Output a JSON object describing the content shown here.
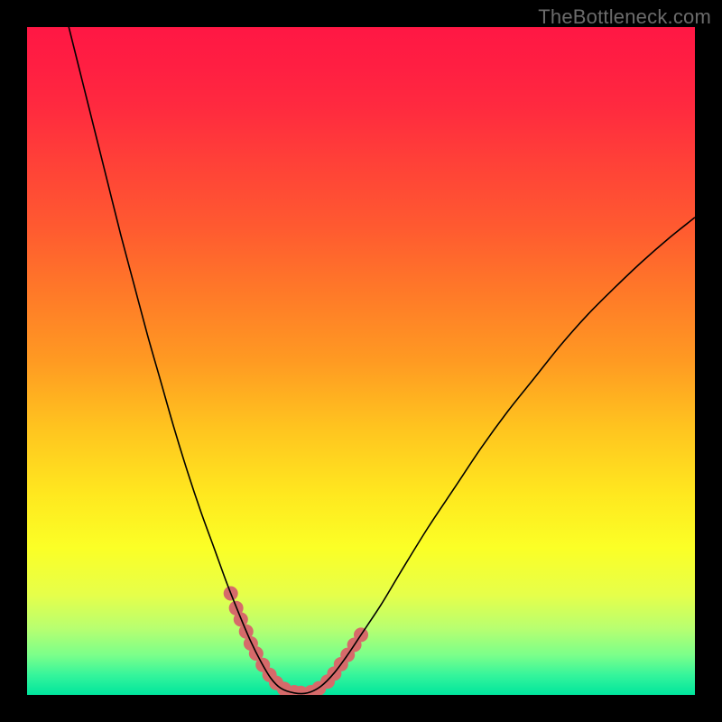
{
  "watermark": "TheBottleneck.com",
  "chart_data": {
    "type": "line",
    "title": "",
    "xlabel": "",
    "ylabel": "",
    "xlim": [
      0,
      100
    ],
    "ylim": [
      0,
      100
    ],
    "background_gradient": {
      "stops": [
        {
          "offset": 0.0,
          "color": "#ff1744"
        },
        {
          "offset": 0.06,
          "color": "#ff1f42"
        },
        {
          "offset": 0.12,
          "color": "#ff2a3f"
        },
        {
          "offset": 0.2,
          "color": "#ff4038"
        },
        {
          "offset": 0.3,
          "color": "#ff5a30"
        },
        {
          "offset": 0.4,
          "color": "#ff7a28"
        },
        {
          "offset": 0.5,
          "color": "#ff9a22"
        },
        {
          "offset": 0.6,
          "color": "#ffc41f"
        },
        {
          "offset": 0.7,
          "color": "#ffe81f"
        },
        {
          "offset": 0.78,
          "color": "#fbff26"
        },
        {
          "offset": 0.85,
          "color": "#e6ff4a"
        },
        {
          "offset": 0.9,
          "color": "#b8ff70"
        },
        {
          "offset": 0.94,
          "color": "#7cff8a"
        },
        {
          "offset": 0.97,
          "color": "#36f59b"
        },
        {
          "offset": 1.0,
          "color": "#00e59d"
        }
      ]
    },
    "series": [
      {
        "name": "bottleneck-curve",
        "color": "#000000",
        "width": 1.6,
        "points": [
          {
            "x": 6.0,
            "y": 101.0
          },
          {
            "x": 8.0,
            "y": 93.0
          },
          {
            "x": 10.0,
            "y": 85.0
          },
          {
            "x": 12.0,
            "y": 77.0
          },
          {
            "x": 14.0,
            "y": 69.0
          },
          {
            "x": 16.0,
            "y": 61.5
          },
          {
            "x": 18.0,
            "y": 54.0
          },
          {
            "x": 20.0,
            "y": 47.0
          },
          {
            "x": 22.0,
            "y": 40.0
          },
          {
            "x": 24.0,
            "y": 33.5
          },
          {
            "x": 26.0,
            "y": 27.5
          },
          {
            "x": 28.0,
            "y": 22.0
          },
          {
            "x": 30.0,
            "y": 16.5
          },
          {
            "x": 32.0,
            "y": 11.5
          },
          {
            "x": 33.5,
            "y": 8.0
          },
          {
            "x": 35.0,
            "y": 5.0
          },
          {
            "x": 36.5,
            "y": 2.5
          },
          {
            "x": 38.0,
            "y": 1.0
          },
          {
            "x": 40.0,
            "y": 0.3
          },
          {
            "x": 42.0,
            "y": 0.3
          },
          {
            "x": 44.0,
            "y": 1.3
          },
          {
            "x": 46.0,
            "y": 3.3
          },
          {
            "x": 48.0,
            "y": 6.0
          },
          {
            "x": 50.0,
            "y": 9.0
          },
          {
            "x": 53.0,
            "y": 13.5
          },
          {
            "x": 56.0,
            "y": 18.5
          },
          {
            "x": 60.0,
            "y": 25.0
          },
          {
            "x": 64.0,
            "y": 31.0
          },
          {
            "x": 68.0,
            "y": 37.0
          },
          {
            "x": 72.0,
            "y": 42.5
          },
          {
            "x": 76.0,
            "y": 47.5
          },
          {
            "x": 80.0,
            "y": 52.5
          },
          {
            "x": 84.0,
            "y": 57.0
          },
          {
            "x": 88.0,
            "y": 61.0
          },
          {
            "x": 92.0,
            "y": 64.8
          },
          {
            "x": 96.0,
            "y": 68.3
          },
          {
            "x": 100.0,
            "y": 71.5
          }
        ]
      }
    ],
    "markers": {
      "name": "highlight-dots",
      "color": "#d66a6a",
      "radius": 8,
      "points": [
        {
          "x": 30.5,
          "y": 15.2
        },
        {
          "x": 31.3,
          "y": 13.0
        },
        {
          "x": 32.0,
          "y": 11.3
        },
        {
          "x": 32.8,
          "y": 9.5
        },
        {
          "x": 33.5,
          "y": 7.7
        },
        {
          "x": 34.3,
          "y": 6.2
        },
        {
          "x": 35.3,
          "y": 4.5
        },
        {
          "x": 36.3,
          "y": 3.0
        },
        {
          "x": 37.3,
          "y": 1.8
        },
        {
          "x": 38.5,
          "y": 0.9
        },
        {
          "x": 40.0,
          "y": 0.4
        },
        {
          "x": 41.0,
          "y": 0.3
        },
        {
          "x": 42.5,
          "y": 0.4
        },
        {
          "x": 43.7,
          "y": 1.0
        },
        {
          "x": 45.0,
          "y": 2.0
        },
        {
          "x": 46.0,
          "y": 3.2
        },
        {
          "x": 47.0,
          "y": 4.6
        },
        {
          "x": 48.0,
          "y": 6.0
        },
        {
          "x": 49.0,
          "y": 7.5
        },
        {
          "x": 50.0,
          "y": 9.0
        }
      ]
    }
  }
}
